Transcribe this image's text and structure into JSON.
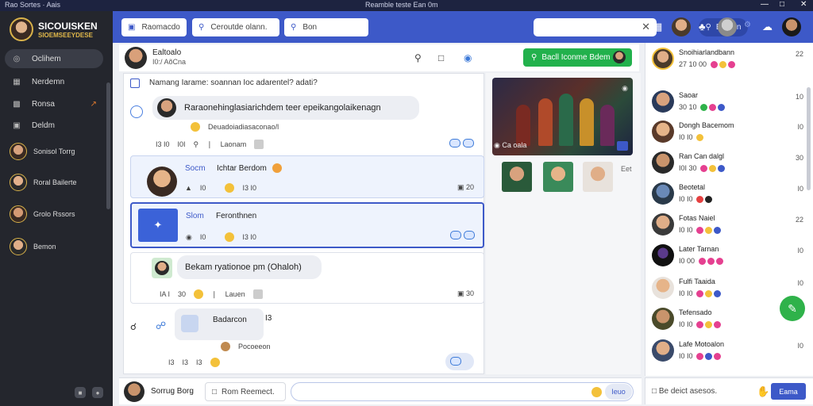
{
  "window": {
    "app_name": "Rao Sortes · Aais",
    "title": "Reamble teste Ean 0m",
    "controls": [
      "—",
      "□",
      "✕"
    ]
  },
  "sidebar": {
    "brand": "SICOUISKEN",
    "tagline": "SIOEMSEEYDESE",
    "nav": [
      {
        "label": "Oclihem",
        "icon": "home-icon"
      },
      {
        "label": "Nerdemn",
        "icon": "image-icon"
      },
      {
        "label": "Ronsa",
        "icon": "people-icon"
      },
      {
        "label": "Deldm",
        "icon": "screen-icon"
      }
    ],
    "contacts": [
      {
        "label": "Sonisol Torrg"
      },
      {
        "label": "Roral Bailerte"
      },
      {
        "label": "Grolo Rssors"
      },
      {
        "label": "Bemon"
      }
    ]
  },
  "topbar": {
    "fields": [
      {
        "label": "Raomacdo",
        "icon": "calendar-icon"
      },
      {
        "label": "Ceroutde olann.",
        "icon": "search-icon"
      },
      {
        "label": "Bon",
        "icon": "search-icon"
      }
    ],
    "search": {
      "placeholder": ""
    },
    "pill_label": "Bemen"
  },
  "chat_header": {
    "name": "Ealtoalo",
    "status": "I0:/ AõCna",
    "call_label": "Bacll Iconme Bdem"
  },
  "messages": [
    {
      "author": "",
      "text": "Namang Iarame: soannan Ioc adarentel? adati?",
      "kind": "header"
    },
    {
      "text": "Raraonehinglasiarichdem teer epeikangolaikenagn",
      "meta": [
        "I3 I0",
        "I0I",
        "Laonam"
      ],
      "sub": "Deuadoiadiasaconao/l"
    },
    {
      "author": "Socm",
      "text": "Ichtar Berdom",
      "meta": [
        "I0",
        "I3 I0"
      ]
    },
    {
      "author": "Slom",
      "text": "Feronthnen",
      "meta": [
        "I0",
        "I3 I0"
      ]
    },
    {
      "text": "Bekam ryationoe pm (Ohaloh)",
      "meta": [
        "IA I",
        "30",
        "Lauen"
      ]
    },
    {
      "author": "Badarcon",
      "text": "I3",
      "sub": "Pocoeeon",
      "meta": [
        "I3",
        "I3",
        "I3"
      ]
    }
  ],
  "media": {
    "caption": "Ca oala",
    "side_label": "Eet"
  },
  "right_panel": {
    "items": [
      {
        "name": "Snoihiarlandbann",
        "sub": "27 10 00",
        "time": "22",
        "ring": "#f3c13a"
      },
      {
        "name": "Saoar",
        "sub": "30 10",
        "time": "10",
        "ring": "#2fb24a"
      },
      {
        "name": "Dongh Bacemom",
        "sub": "I0 I0",
        "time": "I0",
        "ring": "#2fb24a"
      },
      {
        "name": "Ran Can dalgl",
        "sub": "I0I 30",
        "time": "30",
        "ring": "#2fb24a"
      },
      {
        "name": "Beotetal",
        "sub": "I0 I0",
        "time": "I0",
        "ring": "#3d59c8"
      },
      {
        "name": "Fotas Naiel",
        "sub": "I0 I0",
        "time": "22",
        "ring": "#e54090"
      },
      {
        "name": "Later Tarnan",
        "sub": "I0 00",
        "time": "I0",
        "ring": "#e54090"
      },
      {
        "name": "Fulfi Taaida",
        "sub": "I0 I0",
        "time": "I0",
        "ring": "#e54090"
      },
      {
        "name": "Tefensado",
        "sub": "I0 I0",
        "time": "I0",
        "ring": "#e54090"
      },
      {
        "name": "Lafe Motoalon",
        "sub": "I0 I0",
        "time": "I0",
        "ring": "#e54090"
      }
    ]
  },
  "composer": {
    "user": "Sorrug Borg",
    "field": "Rom Reemect.",
    "send_label": "Ieuo"
  },
  "right_composer": {
    "placeholder": "Be deict asesos.",
    "button": "Eama"
  },
  "colors": {
    "accent": "#3d59c8",
    "sidebar": "#24262d",
    "call": "#22b14c"
  }
}
